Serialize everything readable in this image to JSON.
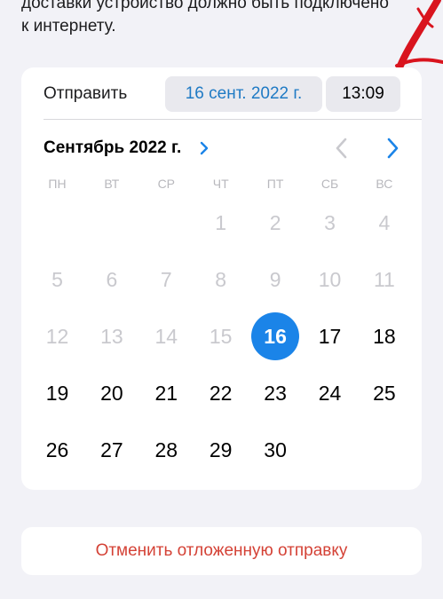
{
  "description": {
    "line1": "доставки устройство должно быть подключено",
    "line2": "к интернету."
  },
  "send_row": {
    "label": "Отправить",
    "date": "16 сент. 2022 г.",
    "time": "13:09"
  },
  "calendar": {
    "month_title": "Сентябрь 2022 г.",
    "weekdays": [
      "ПН",
      "ВТ",
      "СР",
      "ЧТ",
      "ПТ",
      "СБ",
      "ВС"
    ],
    "first_weekday_index": 3,
    "days_in_month": 30,
    "selected_day": 16,
    "first_enabled_day": 16
  },
  "cancel_button": {
    "label": "Отменить отложенную отправку"
  },
  "colors": {
    "accent": "#1b84e8",
    "destructive": "#d44236",
    "disabled_text": "#c9c9ce",
    "annotation": "#d9141e"
  },
  "icons": {
    "month_chevron": "chevron-right-icon",
    "prev_month": "chevron-left-icon",
    "next_month": "chevron-right-icon"
  }
}
